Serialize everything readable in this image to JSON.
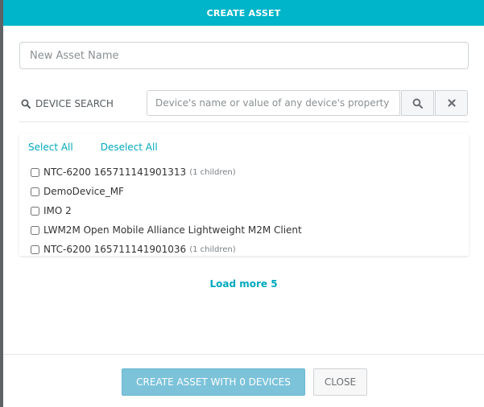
{
  "modal": {
    "title": "CREATE ASSET"
  },
  "asset_name": {
    "placeholder": "New Asset Name",
    "value": ""
  },
  "device_search": {
    "label": "DEVICE SEARCH",
    "placeholder": "Device's name or value of any device's property",
    "search_icon": "search-icon",
    "clear_icon": "close-icon"
  },
  "selection": {
    "select_all": "Select All",
    "deselect_all": "Deselect All"
  },
  "devices": [
    {
      "name": "NTC-6200 165711141901313",
      "children": "(1 children)",
      "checked": false
    },
    {
      "name": "DemoDevice_MF",
      "children": "",
      "checked": false
    },
    {
      "name": "IMO 2",
      "children": "",
      "checked": false
    },
    {
      "name": "LWM2M Open Mobile Alliance Lightweight M2M Client",
      "children": "",
      "checked": false
    },
    {
      "name": "NTC-6200 165711141901036",
      "children": "(1 children)",
      "checked": false
    }
  ],
  "load_more": "Load more 5",
  "footer": {
    "create_label": "CREATE ASSET WITH 0 DEVICES",
    "close_label": "CLOSE"
  },
  "colors": {
    "accent": "#00b4c9",
    "link": "#00a9bd",
    "primary_button_disabled": "#7cc3da"
  }
}
